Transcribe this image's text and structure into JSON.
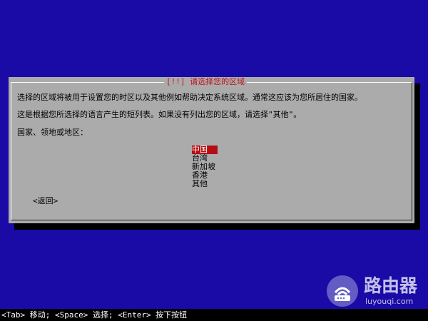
{
  "dialog": {
    "title": "[!!] 请选择您的区域",
    "description_line1": "选择的区域将被用于设置您的时区以及其他例如帮助决定系统区域。通常这应该为您所居住的国家。",
    "description_line2": "这是根据您所选择的语言产生的短列表。如果没有列出您的区域，请选择\"其他\"。",
    "prompt": "国家、领地或地区：",
    "options": [
      "中国",
      "台湾",
      "新加坡",
      "香港",
      "其他"
    ],
    "selected": "中国",
    "back_label": "<返回>"
  },
  "statusbar": {
    "text": "<Tab> 移动; <Space> 选择; <Enter> 按下按钮"
  },
  "watermark": {
    "name": "路由器",
    "url": "luyouqi.com"
  },
  "colors": {
    "background": "#1a0aa6",
    "dialog": "#ababab",
    "accent": "#c0121a"
  }
}
